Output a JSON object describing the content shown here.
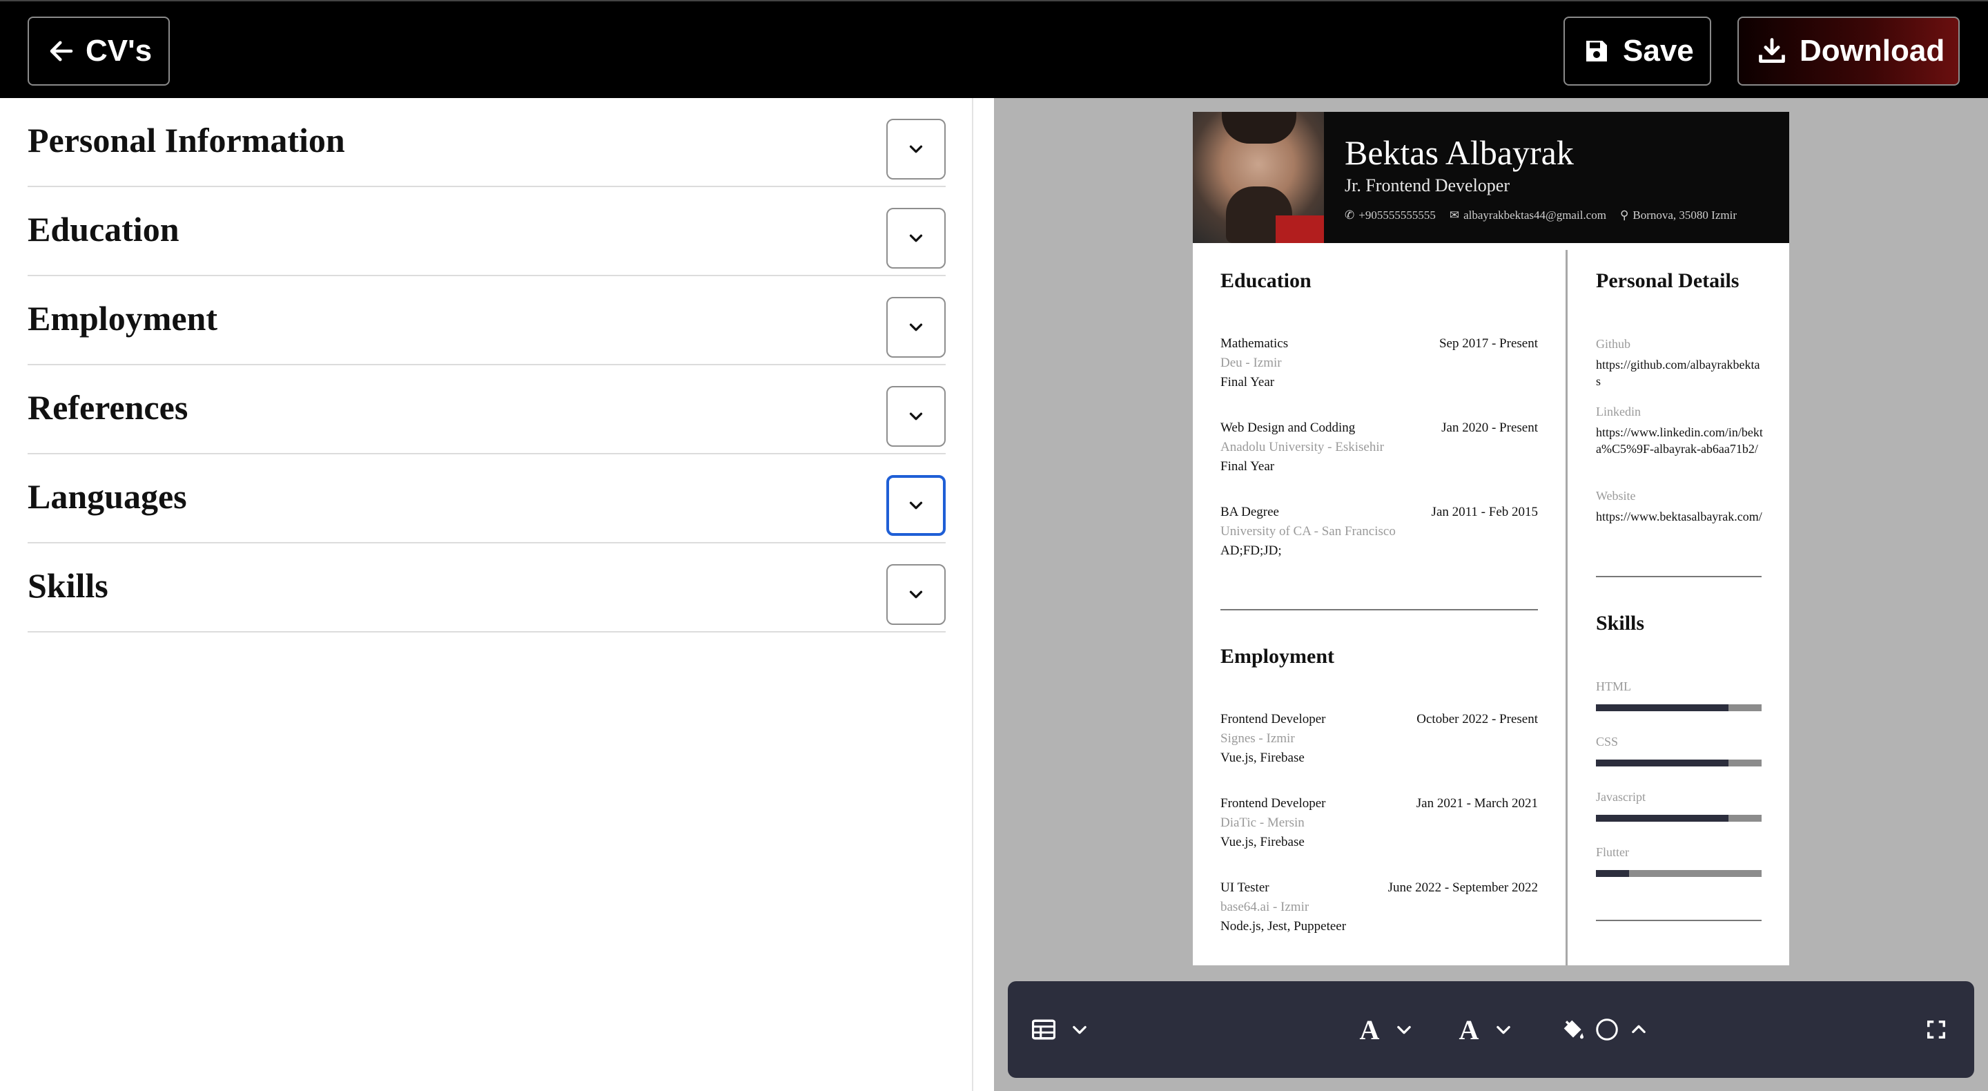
{
  "topbar": {
    "back_label": "CV's",
    "save_label": "Save",
    "download_label": "Download"
  },
  "sections": [
    {
      "title": "Personal Information"
    },
    {
      "title": "Education"
    },
    {
      "title": "Employment"
    },
    {
      "title": "References"
    },
    {
      "title": "Languages"
    },
    {
      "title": "Skills"
    }
  ],
  "cv": {
    "name": "Bektas Albayrak",
    "role": "Jr. Frontend Developer",
    "phone": "+905555555555",
    "email": "albayrakbektas44@gmail.com",
    "location": "Bornova, 35080 Izmir",
    "education_title": "Education",
    "education": [
      {
        "title": "Mathematics",
        "place": "Deu - Izmir",
        "detail": "Final Year",
        "date": "Sep 2017 - Present"
      },
      {
        "title": "Web Design and Codding",
        "place": "Anadolu University - Eskisehir",
        "detail": "Final Year",
        "date": "Jan 2020 - Present"
      },
      {
        "title": "BA Degree",
        "place": "University of CA - San Francisco",
        "detail": "AD;FD;JD;",
        "date": "Jan 2011 - Feb 2015"
      }
    ],
    "employment_title": "Employment",
    "employment": [
      {
        "title": "Frontend Developer",
        "place": "Signes - Izmir",
        "detail": "Vue.js, Firebase",
        "date": "October 2022 - Present"
      },
      {
        "title": "Frontend Developer",
        "place": "DiaTic - Mersin",
        "detail": "Vue.js, Firebase",
        "date": "Jan 2021 - March 2021"
      },
      {
        "title": "UI Tester",
        "place": "base64.ai - Izmir",
        "detail": "Node.js, Jest, Puppeteer",
        "date": "June 2022 - September 2022"
      }
    ],
    "personal_title": "Personal Details",
    "personal": [
      {
        "label": "Github",
        "value": "https://github.com/albayrakbektas"
      },
      {
        "label": "Linkedin",
        "value": "https://www.linkedin.com/in/bekta%C5%9F-albayrak-ab6aa71b2/"
      },
      {
        "label": "Website",
        "value": "https://www.bektasalbayrak.com/"
      }
    ],
    "skills_title": "Skills",
    "skills": [
      {
        "name": "HTML",
        "level": 0.8
      },
      {
        "name": "CSS",
        "level": 0.8
      },
      {
        "name": "Javascript",
        "level": 0.8
      },
      {
        "name": "Flutter",
        "level": 0.2
      }
    ]
  },
  "toolbar": {
    "icons": [
      "table-layout-icon",
      "chevron-down-icon",
      "font-icon",
      "chevron-down-icon",
      "font-icon",
      "chevron-down-icon",
      "paint-bucket-icon",
      "color-circle-icon",
      "chevron-up-icon",
      "fullscreen-icon"
    ],
    "font_glyph": "A"
  },
  "colors": {
    "topbar": "#000000",
    "preview_bg": "#b3b3b3",
    "toolbar_bg": "#2c2e3d",
    "focus_ring": "#1f5fd6",
    "skill_fill": "#2c2e3d"
  }
}
